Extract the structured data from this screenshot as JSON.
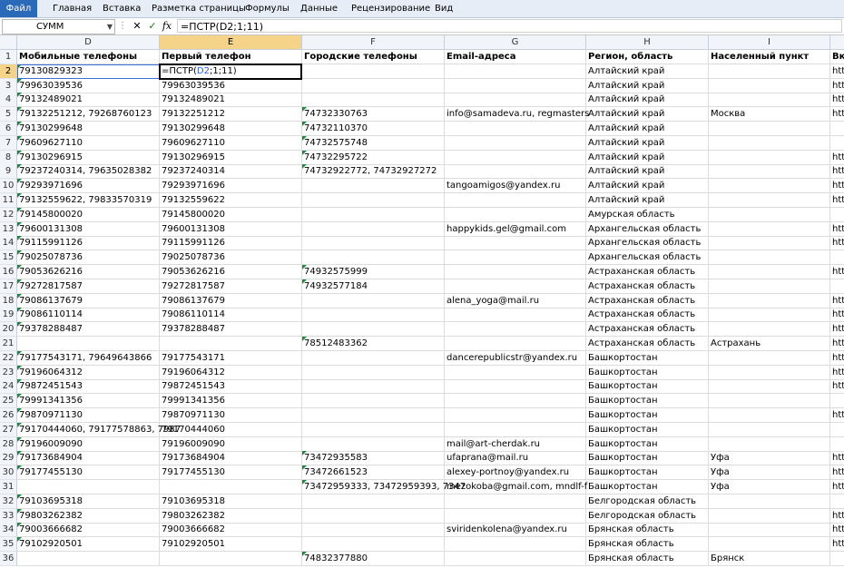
{
  "ribbon": {
    "tabs": [
      "Файл",
      "Главная",
      "Вставка",
      "Разметка страницы",
      "Формулы",
      "Данные",
      "Рецензирование",
      "Вид"
    ]
  },
  "formula_bar": {
    "name_box": "СУММ",
    "cancel_icon": "✕",
    "enter_icon": "✓",
    "fx_label": "fx",
    "formula": "=ПСТР(D2;1;11)"
  },
  "editing": {
    "prefix": "=ПСТР(",
    "ref": "D2",
    "suffix": ";1;11)"
  },
  "columns": [
    {
      "letter": "D",
      "header": "Мобильные телефоны"
    },
    {
      "letter": "E",
      "header": "Первый телефон"
    },
    {
      "letter": "F",
      "header": "Городские телефоны"
    },
    {
      "letter": "G",
      "header": "Email-адреса"
    },
    {
      "letter": "H",
      "header": "Регион, область"
    },
    {
      "letter": "I",
      "header": "Населенный пункт"
    },
    {
      "letter": "J",
      "header": "Вк"
    }
  ],
  "rows": [
    {
      "n": "2",
      "d": "79130829323",
      "e": "",
      "f": "",
      "g": "",
      "h": "Алтайский край",
      "i": "",
      "j": "htt"
    },
    {
      "n": "3",
      "d": "79963039536",
      "e": "79963039536",
      "f": "",
      "g": "",
      "h": "Алтайский край",
      "i": "",
      "j": "htt"
    },
    {
      "n": "4",
      "d": "79132489021",
      "e": "79132489021",
      "f": "",
      "g": "",
      "h": "Алтайский край",
      "i": "",
      "j": "htt"
    },
    {
      "n": "5",
      "d": "79132251212, 79268760123",
      "e": "79132251212",
      "f": "74732330763",
      "g": "info@samadeva.ru, regmasters",
      "h": "Алтайский край",
      "i": "Москва",
      "j": "htt"
    },
    {
      "n": "6",
      "d": "79130299648",
      "e": "79130299648",
      "f": "74732110370",
      "g": "",
      "h": "Алтайский край",
      "i": "",
      "j": ""
    },
    {
      "n": "7",
      "d": "79609627110",
      "e": "79609627110",
      "f": "74732575748",
      "g": "",
      "h": "Алтайский край",
      "i": "",
      "j": ""
    },
    {
      "n": "8",
      "d": "79130296915",
      "e": "79130296915",
      "f": "74732295722",
      "g": "",
      "h": "Алтайский край",
      "i": "",
      "j": "htt"
    },
    {
      "n": "9",
      "d": "79237240314, 79635028382",
      "e": "79237240314",
      "f": "74732922772, 74732927272",
      "g": "",
      "h": "Алтайский край",
      "i": "",
      "j": "htt"
    },
    {
      "n": "10",
      "d": "79293971696",
      "e": "79293971696",
      "f": "",
      "g": "tangoamigos@yandex.ru",
      "h": "Алтайский край",
      "i": "",
      "j": "htt"
    },
    {
      "n": "11",
      "d": "79132559622, 79833570319",
      "e": "79132559622",
      "f": "",
      "g": "",
      "h": "Алтайский край",
      "i": "",
      "j": "htt"
    },
    {
      "n": "12",
      "d": "79145800020",
      "e": "79145800020",
      "f": "",
      "g": "",
      "h": "Амурская область",
      "i": "",
      "j": ""
    },
    {
      "n": "13",
      "d": "79600131308",
      "e": "79600131308",
      "f": "",
      "g": "happykids.gel@gmail.com",
      "h": "Архангельская область",
      "i": "",
      "j": "htt"
    },
    {
      "n": "14",
      "d": "79115991126",
      "e": "79115991126",
      "f": "",
      "g": "",
      "h": "Архангельская область",
      "i": "",
      "j": "htt"
    },
    {
      "n": "15",
      "d": "79025078736",
      "e": "79025078736",
      "f": "",
      "g": "",
      "h": "Архангельская область",
      "i": "",
      "j": ""
    },
    {
      "n": "16",
      "d": "79053626216",
      "e": "79053626216",
      "f": "74932575999",
      "g": "",
      "h": "Астраханская область",
      "i": "",
      "j": "htt"
    },
    {
      "n": "17",
      "d": "79272817587",
      "e": "79272817587",
      "f": "74932577184",
      "g": "",
      "h": "Астраханская область",
      "i": "",
      "j": ""
    },
    {
      "n": "18",
      "d": "79086137679",
      "e": "79086137679",
      "f": "",
      "g": "alena_yoga@mail.ru",
      "h": "Астраханская область",
      "i": "",
      "j": "htt"
    },
    {
      "n": "19",
      "d": "79086110114",
      "e": "79086110114",
      "f": "",
      "g": "",
      "h": "Астраханская область",
      "i": "",
      "j": "htt"
    },
    {
      "n": "20",
      "d": "79378288487",
      "e": "79378288487",
      "f": "",
      "g": "",
      "h": "Астраханская область",
      "i": "",
      "j": "htt"
    },
    {
      "n": "21",
      "d": "",
      "e": "",
      "f": "78512483362",
      "g": "",
      "h": "Астраханская область",
      "i": "Астрахань",
      "j": "htt"
    },
    {
      "n": "22",
      "d": "79177543171, 79649643866",
      "e": "79177543171",
      "f": "",
      "g": "dancerepublicstr@yandex.ru",
      "h": "Башкортостан",
      "i": "",
      "j": "htt"
    },
    {
      "n": "23",
      "d": "79196064312",
      "e": "79196064312",
      "f": "",
      "g": "",
      "h": "Башкортостан",
      "i": "",
      "j": "htt"
    },
    {
      "n": "24",
      "d": "79872451543",
      "e": "79872451543",
      "f": "",
      "g": "",
      "h": "Башкортостан",
      "i": "",
      "j": "htt"
    },
    {
      "n": "25",
      "d": "79991341356",
      "e": "79991341356",
      "f": "",
      "g": "",
      "h": "Башкортостан",
      "i": "",
      "j": ""
    },
    {
      "n": "26",
      "d": "79870971130",
      "e": "79870971130",
      "f": "",
      "g": "",
      "h": "Башкортостан",
      "i": "",
      "j": "htt"
    },
    {
      "n": "27",
      "d": "79170444060, 79177578863, 7987",
      "e": "79170444060",
      "f": "",
      "g": "",
      "h": "Башкортостан",
      "i": "",
      "j": ""
    },
    {
      "n": "28",
      "d": "79196009090",
      "e": "79196009090",
      "f": "",
      "g": "mail@art-cherdak.ru",
      "h": "Башкортостан",
      "i": "",
      "j": ""
    },
    {
      "n": "29",
      "d": "79173684904",
      "e": "79173684904",
      "f": "73472935583",
      "g": "ufaprana@mail.ru",
      "h": "Башкортостан",
      "i": "Уфа",
      "j": "htt"
    },
    {
      "n": "30",
      "d": "79177455130",
      "e": "79177455130",
      "f": "73472661523",
      "g": "alexey-portnoy@yandex.ru",
      "h": "Башкортостан",
      "i": "Уфа",
      "j": "htt"
    },
    {
      "n": "31",
      "d": "",
      "e": "",
      "f": "73472959333, 73472959393, 7347",
      "g": "mezokoba@gmail.com, mndlf-f",
      "h": "Башкортостан",
      "i": "Уфа",
      "j": "htt"
    },
    {
      "n": "32",
      "d": "79103695318",
      "e": "79103695318",
      "f": "",
      "g": "",
      "h": "Белгородская область",
      "i": "",
      "j": ""
    },
    {
      "n": "33",
      "d": "79803262382",
      "e": "79803262382",
      "f": "",
      "g": "",
      "h": "Белгородская область",
      "i": "",
      "j": "htt"
    },
    {
      "n": "34",
      "d": "79003666682",
      "e": "79003666682",
      "f": "",
      "g": "sviridenkolena@yandex.ru",
      "h": "Брянская область",
      "i": "",
      "j": "htt"
    },
    {
      "n": "35",
      "d": "79102920501",
      "e": "79102920501",
      "f": "",
      "g": "",
      "h": "Брянская область",
      "i": "",
      "j": "htt"
    },
    {
      "n": "36",
      "d": "",
      "e": "",
      "f": "74832377880",
      "g": "",
      "h": "Брянская область",
      "i": "Брянск",
      "j": ""
    }
  ]
}
